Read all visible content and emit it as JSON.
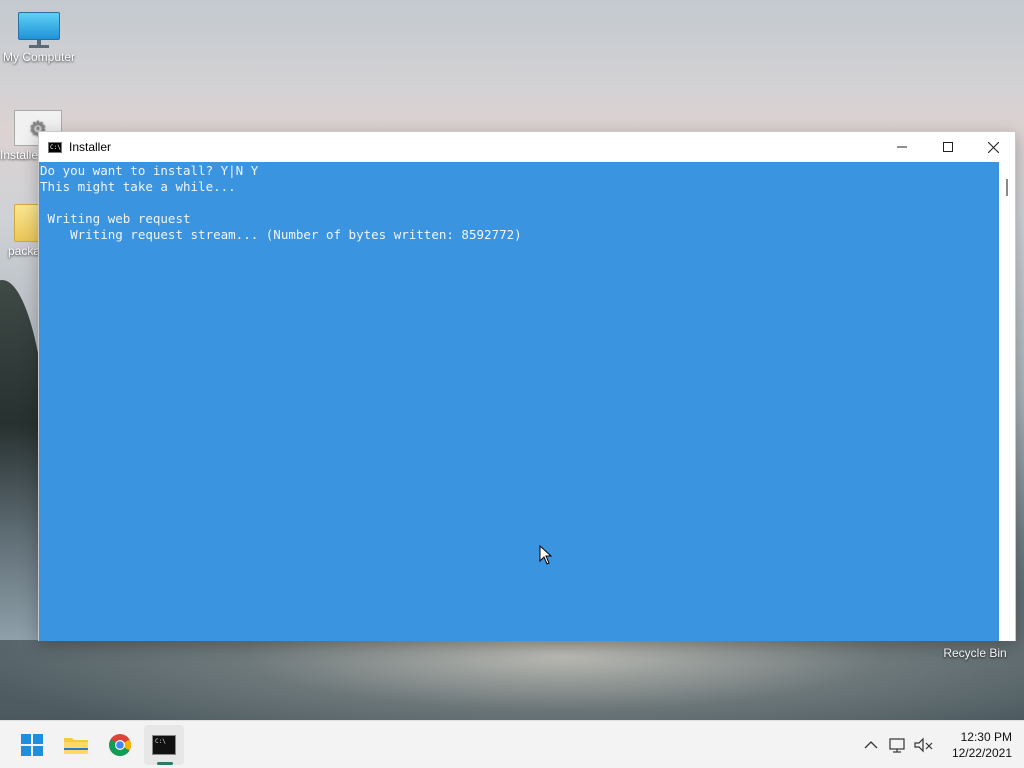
{
  "desktop": {
    "icons": [
      {
        "label": "My Computer",
        "icon": "monitor-icon"
      },
      {
        "label": "Installe",
        "icon": "installer-icon"
      },
      {
        "label": "packa",
        "icon": "folder-icon"
      }
    ],
    "recycle_bin_label": "Recycle Bin"
  },
  "window": {
    "title": "Installer",
    "icon": "console-icon",
    "controls": {
      "minimize": "minimize-icon",
      "maximize": "maximize-icon",
      "close": "close-icon"
    },
    "console_lines": [
      "Do you want to install? Y|N Y",
      "This might take a while...",
      "",
      " Writing web request",
      "    Writing request stream... (Number of bytes written: 8592772)"
    ],
    "background_color": "#3b94e0",
    "text_color": "#eef5fc"
  },
  "taskbar": {
    "apps": [
      {
        "name": "start",
        "icon": "windows-start-icon"
      },
      {
        "name": "file-explorer",
        "icon": "folder-icon"
      },
      {
        "name": "chrome",
        "icon": "chrome-icon"
      },
      {
        "name": "console",
        "icon": "console-icon",
        "active": true
      }
    ],
    "tray": [
      "chevron-up-icon",
      "network-icon",
      "volume-muted-icon"
    ],
    "clock": {
      "time": "12:30 PM",
      "date": "12/22/2021"
    }
  }
}
